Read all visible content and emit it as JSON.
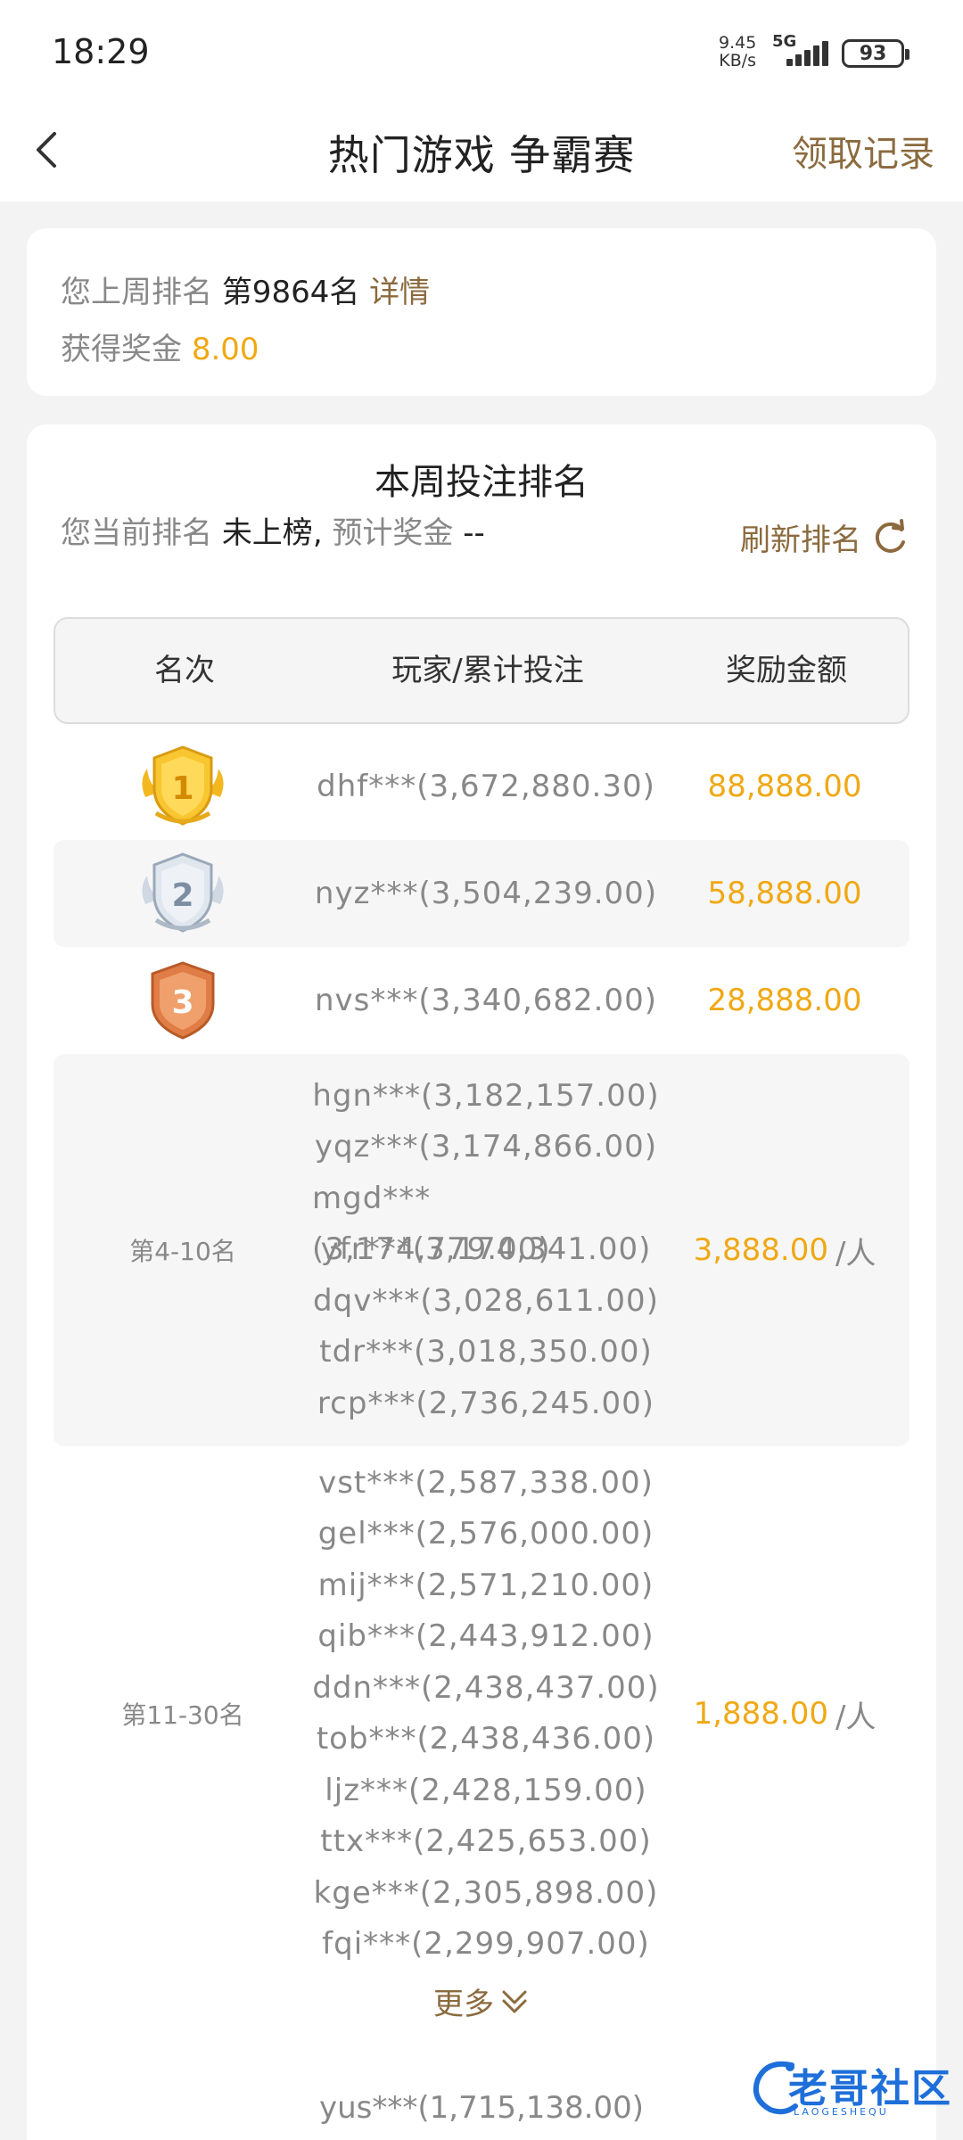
{
  "status_bar": {
    "time": "18:29",
    "speed_value": "9.45",
    "speed_unit": "KB/s",
    "network": "5G",
    "battery": "93"
  },
  "header": {
    "title": "热门游戏 争霸赛",
    "right_link": "领取记录"
  },
  "last_week": {
    "rank_label": "您上周排名",
    "rank_value": "第9864名",
    "details_link": "详情",
    "bonus_label": "获得奖金",
    "bonus_value": "8.00"
  },
  "this_week": {
    "title": "本周投注排名",
    "current_rank_label": "您当前排名",
    "current_rank_value": "未上榜",
    "comma": ",",
    "expected_bonus_label": "预计奖金",
    "expected_bonus_value": "--",
    "refresh_label": "刷新排名"
  },
  "table": {
    "headers": [
      "名次",
      "玩家/累计投注",
      "奖励金额"
    ],
    "top3": [
      {
        "rank": "1",
        "player": "dhf***(3,672,880.30)",
        "reward": "88,888.00"
      },
      {
        "rank": "2",
        "player": "nyz***(3,504,239.00)",
        "reward": "58,888.00"
      },
      {
        "rank": "3",
        "player": "nvs***(3,340,682.00)",
        "reward": "28,888.00"
      }
    ],
    "groups": [
      {
        "rank_label": "第4-10名",
        "reward": "3,888.00",
        "per": "/人",
        "players": [
          "hgn***(3,182,157.00)",
          "yqz***(3,174,866.00)",
          "mgd***(3,174,779.00)",
          "yfr***(3,174,341.00)",
          "dqv***(3,028,611.00)",
          "tdr***(3,018,350.00)",
          "rcp***(2,736,245.00)"
        ]
      },
      {
        "rank_label": "第11-30名",
        "reward": "1,888.00",
        "per": "/人",
        "players": [
          "vst***(2,587,338.00)",
          "gel***(2,576,000.00)",
          "mij***(2,571,210.00)",
          "qib***(2,443,912.00)",
          "ddn***(2,438,437.00)",
          "tob***(2,438,436.00)",
          "ljz***(2,428,159.00)",
          "ttx***(2,425,653.00)",
          "kge***(2,305,898.00)",
          "fqi***(2,299,907.00)"
        ]
      }
    ],
    "more_label": "更多",
    "next_peek": "yus***(1,715,138.00)"
  },
  "watermark": {
    "text": "老哥社区",
    "sub": "LAOGESHEQU"
  },
  "colors": {
    "gold": "#8b6a3e",
    "orange": "#f0a814",
    "gray_text": "#888888"
  }
}
